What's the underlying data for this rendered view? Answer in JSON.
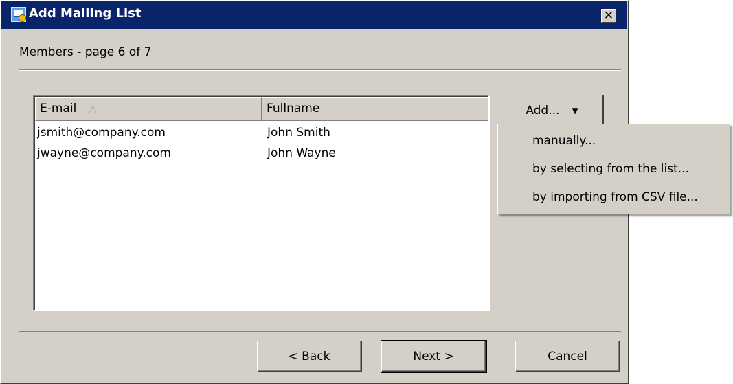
{
  "window": {
    "title": "Add Mailing List",
    "icon": "mailing-list-icon",
    "close_label": "✕"
  },
  "page": {
    "heading": "Members - page 6 of 7"
  },
  "table": {
    "columns": [
      {
        "label": "E-mail",
        "sort": "ascending"
      },
      {
        "label": "Fullname"
      }
    ],
    "sort_indicator": "△",
    "rows": [
      {
        "email": "jsmith@company.com",
        "fullname": "John Smith"
      },
      {
        "email": "jwayne@company.com",
        "fullname": "John Wayne"
      }
    ]
  },
  "add_button": {
    "label": "Add...",
    "caret": "▼"
  },
  "add_menu": {
    "items": [
      {
        "label": "manually..."
      },
      {
        "label": "by selecting from the list..."
      },
      {
        "label": "by importing from CSV file..."
      }
    ]
  },
  "footer": {
    "back_label": "< Back",
    "next_label": "Next >",
    "cancel_label": "Cancel"
  },
  "colors": {
    "titlebar": "#0a246a",
    "dialog_face": "#d4d0c8",
    "list_background": "#ffffff"
  }
}
